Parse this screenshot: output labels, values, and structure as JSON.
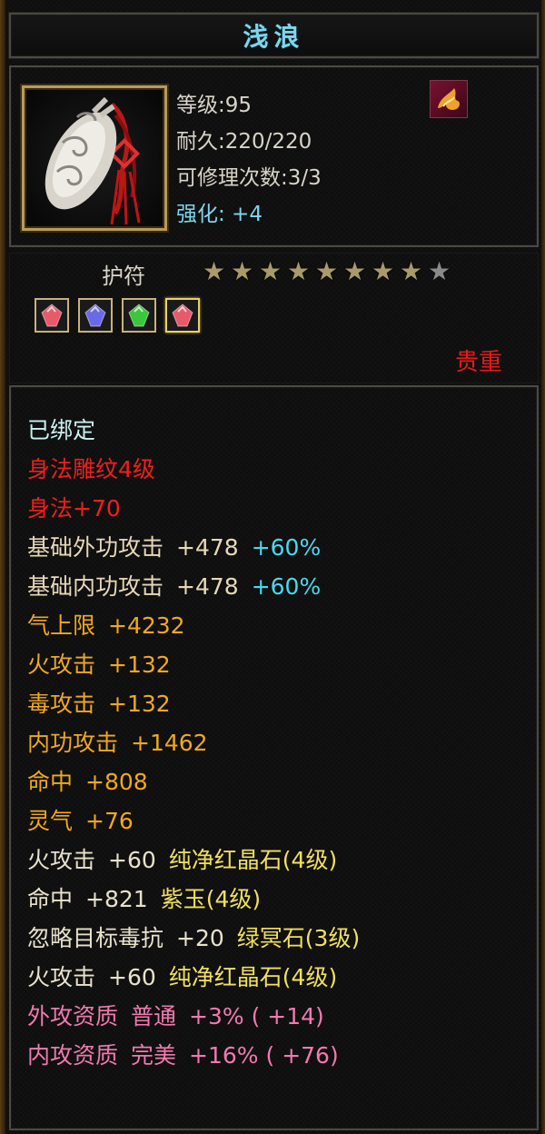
{
  "title": "浅浪",
  "item": {
    "icon": "jade-amulet-icon",
    "level": "等级:95",
    "durability": "耐久:220/220",
    "repair": "可修理次数:3/3",
    "enhance": "强化: +4",
    "corner_icon": "phoenix-emblem-icon"
  },
  "type": "护符",
  "stars": {
    "filled": 8,
    "total": 9
  },
  "gems": [
    {
      "icon": "red-crystal-icon",
      "color": "#e85a6a"
    },
    {
      "icon": "purple-jade-icon",
      "color": "#6a6ae8"
    },
    {
      "icon": "green-stone-icon",
      "color": "#3ac83a"
    },
    {
      "icon": "red-crystal-icon",
      "color": "#e85a6a"
    }
  ],
  "rarity": "贵重",
  "properties": [
    {
      "text": "已绑定",
      "color": "#c9f2f2"
    },
    {
      "text": "身法雕纹4级",
      "color": "#f01e1e"
    },
    {
      "text": "身法+70",
      "color": "#f01e1e"
    },
    {
      "text": "基础外功攻击",
      "value": "+478",
      "extra": "+60%",
      "color": "#e8d8b8",
      "extra_color": "#4ad8f0"
    },
    {
      "text": "基础内功攻击",
      "value": "+478",
      "extra": "+60%",
      "color": "#e8d8b8",
      "extra_color": "#4ad8f0"
    },
    {
      "text": "气上限",
      "value": "+4232",
      "color": "#f0a820"
    },
    {
      "text": "火攻击",
      "value": "+132",
      "color": "#f0a820"
    },
    {
      "text": "毒攻击",
      "value": "+132",
      "color": "#f0a820"
    },
    {
      "text": "内功攻击",
      "value": "+1462",
      "color": "#f0a820"
    },
    {
      "text": "命中",
      "value": "+808",
      "color": "#f0a820"
    },
    {
      "text": "灵气",
      "value": "+76",
      "color": "#f0a820"
    },
    {
      "text": "火攻击",
      "value": "+60",
      "extra": "纯净红晶石(4级)",
      "color": "#e8e2cc",
      "extra_color": "#f0e060"
    },
    {
      "text": "命中",
      "value": "+821",
      "extra": "紫玉(4级)",
      "color": "#e8e2cc",
      "extra_color": "#f0e060"
    },
    {
      "text": "忽略目标毒抗",
      "value": "+20",
      "extra": "绿冥石(3级)",
      "color": "#e8e2cc",
      "extra_color": "#f0e060"
    },
    {
      "text": "火攻击",
      "value": "+60",
      "extra": "纯净红晶石(4级)",
      "color": "#e8e2cc",
      "extra_color": "#f0e060"
    },
    {
      "text": "外攻资质",
      "value": "普通",
      "extra": "+3% ( +14)",
      "color": "#f07ab0",
      "extra_color": "#f07ab0"
    },
    {
      "text": "内攻资质",
      "value": "完美",
      "extra": "+16% ( +76)",
      "color": "#f07ab0",
      "extra_color": "#f07ab0"
    }
  ]
}
